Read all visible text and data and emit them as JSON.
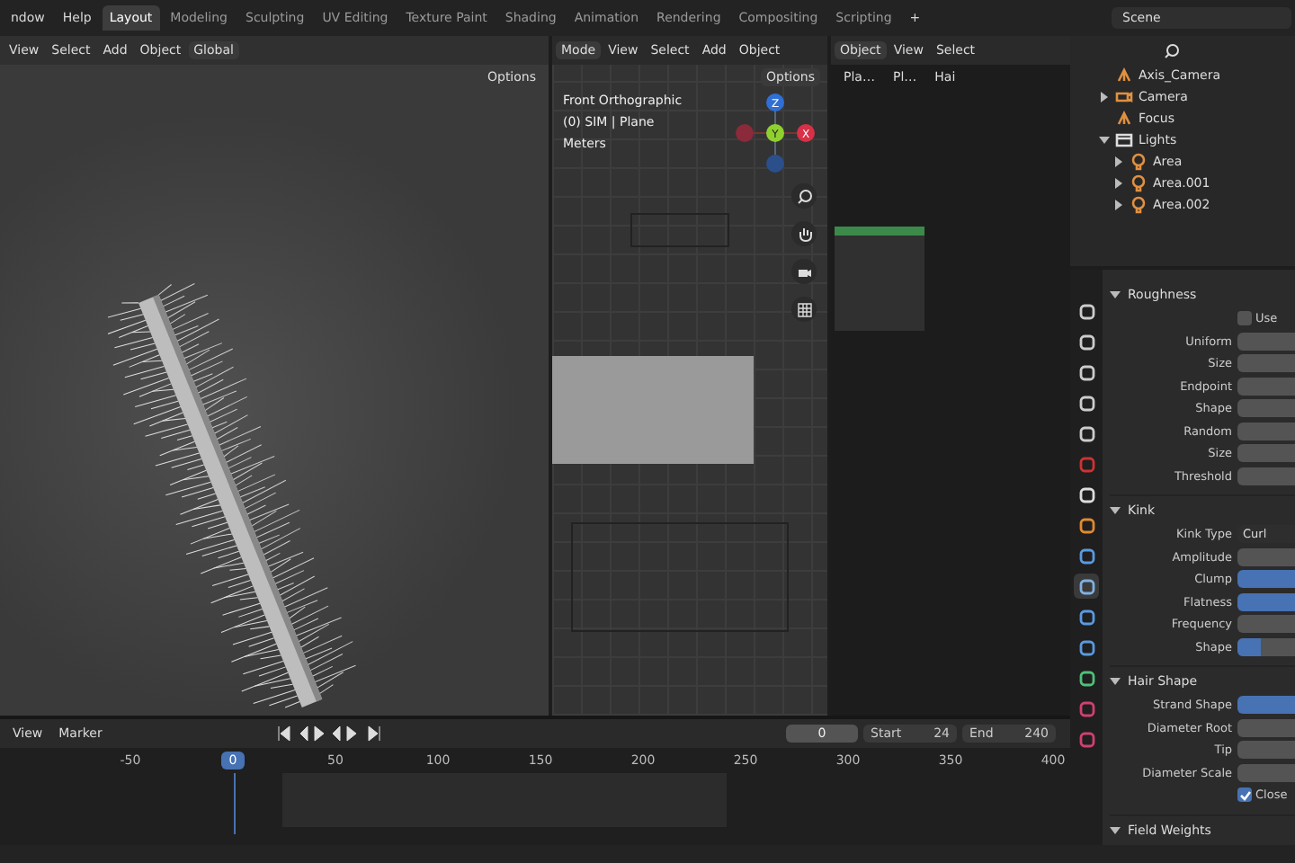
{
  "menu_bar": {
    "menus": [
      "ndow",
      "Help"
    ],
    "workspaces": [
      {
        "label": "Layout",
        "selected": true
      },
      {
        "label": "Modeling",
        "selected": false
      },
      {
        "label": "Sculpting",
        "selected": false
      },
      {
        "label": "UV Editing",
        "selected": false
      },
      {
        "label": "Texture Paint",
        "selected": false
      },
      {
        "label": "Shading",
        "selected": false
      },
      {
        "label": "Animation",
        "selected": false
      },
      {
        "label": "Rendering",
        "selected": false
      },
      {
        "label": "Compositing",
        "selected": false
      },
      {
        "label": "Scripting",
        "selected": false
      }
    ],
    "add_tab": "+",
    "scene": "Scene"
  },
  "viewport_left": {
    "menus": [
      "View",
      "Select",
      "Add",
      "Object"
    ],
    "orientation": "Global",
    "options": "Options"
  },
  "viewport_front": {
    "mode": "Mode",
    "menus": [
      "View",
      "Select",
      "Add",
      "Object"
    ],
    "options": "Options",
    "overlay": [
      "Front Orthographic",
      "(0) SIM | Plane",
      "Meters"
    ],
    "gizmo": {
      "z": "Z",
      "y": "Y",
      "x": "X"
    }
  },
  "node_editor": {
    "object": "Object",
    "menus": [
      "View",
      "Select"
    ],
    "breadcrumbs": [
      "Pla…",
      "Pl…",
      "Hai"
    ]
  },
  "outliner": {
    "items": [
      {
        "label": "Axis_Camera",
        "kind": "empty"
      },
      {
        "label": "Camera",
        "kind": "camera",
        "expanded": false
      },
      {
        "label": "Focus",
        "kind": "empty"
      },
      {
        "label": "Lights",
        "kind": "collection",
        "expanded": true,
        "children": [
          {
            "label": "Area",
            "kind": "light",
            "expanded": false
          },
          {
            "label": "Area.001",
            "kind": "light",
            "expanded": false
          },
          {
            "label": "Area.002",
            "kind": "light",
            "expanded": false
          }
        ]
      }
    ]
  },
  "property_tabs": [
    {
      "kind": "tool",
      "selected": false
    },
    {
      "kind": "render",
      "selected": false
    },
    {
      "kind": "output",
      "selected": false
    },
    {
      "kind": "view_layer",
      "selected": false
    },
    {
      "kind": "scene",
      "selected": false
    },
    {
      "kind": "world",
      "selected": false
    },
    {
      "kind": "collection",
      "selected": false
    },
    {
      "kind": "object",
      "selected": false
    },
    {
      "kind": "modifier",
      "selected": false
    },
    {
      "kind": "particles",
      "selected": true
    },
    {
      "kind": "physics",
      "selected": false
    },
    {
      "kind": "constraints",
      "selected": false
    },
    {
      "kind": "data",
      "selected": false
    },
    {
      "kind": "material",
      "selected": false
    },
    {
      "kind": "texture",
      "selected": false
    }
  ],
  "properties": {
    "sections": [
      {
        "title": "Roughness",
        "expanded": true,
        "rows": [
          {
            "kind": "checkbox",
            "label": "Use",
            "checked": false
          },
          {
            "kind": "field",
            "label": "Uniform"
          },
          {
            "kind": "field",
            "label": "Size"
          },
          {
            "kind": "field",
            "label": "Endpoint"
          },
          {
            "kind": "field",
            "label": "Shape"
          },
          {
            "kind": "field",
            "label": "Random"
          },
          {
            "kind": "field",
            "label": "Size"
          },
          {
            "kind": "field",
            "label": "Threshold"
          }
        ]
      },
      {
        "title": "Kink",
        "expanded": true,
        "rows": [
          {
            "kind": "dropdown",
            "label": "Kink Type",
            "value": "Curl"
          },
          {
            "kind": "field",
            "label": "Amplitude"
          },
          {
            "kind": "slider",
            "label": "Clump",
            "level": 1
          },
          {
            "kind": "slider",
            "label": "Flatness",
            "level": 1
          },
          {
            "kind": "field",
            "label": "Frequency"
          },
          {
            "kind": "slider",
            "label": "Shape",
            "level": 0.4
          }
        ]
      },
      {
        "title": "Hair Shape",
        "expanded": true,
        "rows": [
          {
            "kind": "slider",
            "label": "Strand Shape",
            "level": 1
          },
          {
            "kind": "field",
            "label": "Diameter Root"
          },
          {
            "kind": "field",
            "label": "Tip"
          },
          {
            "kind": "field",
            "label": "Diameter Scale"
          },
          {
            "kind": "checkbox",
            "label": "Close",
            "checked": true
          }
        ]
      },
      {
        "title": "Field Weights",
        "expanded": true
      }
    ]
  },
  "timeline": {
    "menus": [
      "View",
      "Marker"
    ],
    "frame": "0",
    "start_label": "Start",
    "start": "24",
    "end_label": "End",
    "end": "240",
    "ticks": [
      {
        "label": "-50",
        "current": false
      },
      {
        "label": "0",
        "current": true
      },
      {
        "label": "50",
        "current": false
      },
      {
        "label": "100",
        "current": false
      },
      {
        "label": "150",
        "current": false
      },
      {
        "label": "200",
        "current": false
      },
      {
        "label": "250",
        "current": false
      },
      {
        "label": "300",
        "current": false
      },
      {
        "label": "350",
        "current": false
      },
      {
        "label": "400",
        "current": false
      }
    ]
  }
}
